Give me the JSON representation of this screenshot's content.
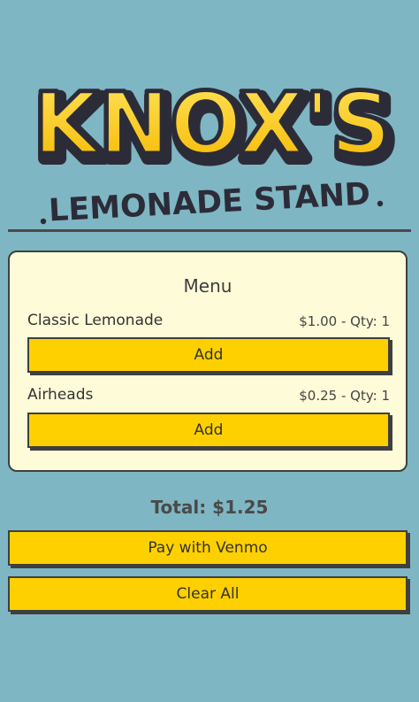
{
  "logo": {
    "title": "KNOX'S",
    "subtitle": "LEMONADE STAND"
  },
  "menu": {
    "title": "Menu",
    "items": [
      {
        "name": "Classic Lemonade",
        "meta": "$1.00 - Qty: 1",
        "button_label": "Add"
      },
      {
        "name": "Airheads",
        "meta": "$0.25 - Qty: 1",
        "button_label": "Add"
      }
    ]
  },
  "total": "Total: $1.25",
  "actions": {
    "pay_label": "Pay with Venmo",
    "clear_label": "Clear All"
  },
  "colors": {
    "background": "#7fb6c3",
    "card": "#fefbd9",
    "button": "#ffd000",
    "logo_yellow": "#ffd42a"
  }
}
